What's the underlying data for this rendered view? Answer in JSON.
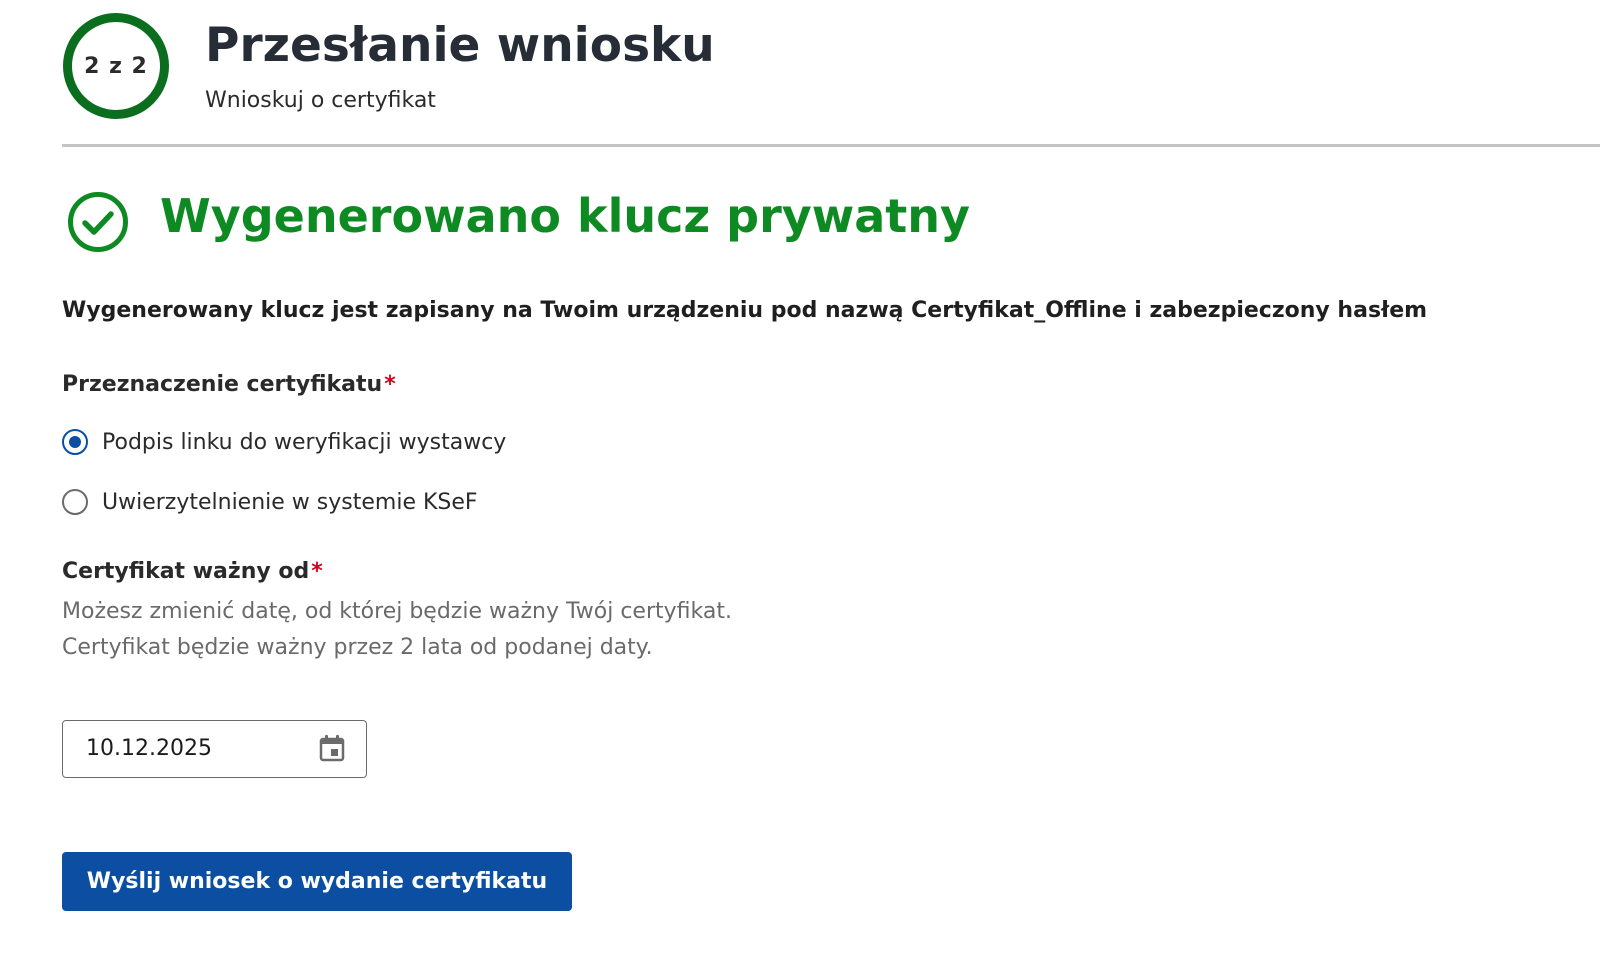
{
  "header": {
    "step": "2 z 2",
    "title": "Przesłanie wniosku",
    "subtitle": "Wnioskuj o certyfikat"
  },
  "success": {
    "icon": "check-circle-icon",
    "title": "Wygenerowano klucz prywatny",
    "color": "#0e8a22"
  },
  "info": "Wygenerowany klucz jest zapisany na Twoim urządzeniu pod nazwą Certyfikat_Offline i zabezpieczony hasłem",
  "purpose": {
    "label": "Przeznaczenie certyfikatu",
    "required_mark": "*",
    "options": [
      {
        "label": "Podpis linku do weryfikacji wystawcy",
        "checked": true
      },
      {
        "label": "Uwierzytelnienie w systemie KSeF",
        "checked": false
      }
    ]
  },
  "valid_from": {
    "label": "Certyfikat ważny od",
    "required_mark": "*",
    "hint": "Możesz zmienić datę, od której będzie ważny Twój certyfikat. Certyfikat będzie ważny przez 2 lata od podanej daty.",
    "value": "10.12.2025",
    "icon": "calendar-icon"
  },
  "submit": {
    "label": "Wyślij wniosek o wydanie certyfikatu",
    "color": "#0b4ea2"
  }
}
